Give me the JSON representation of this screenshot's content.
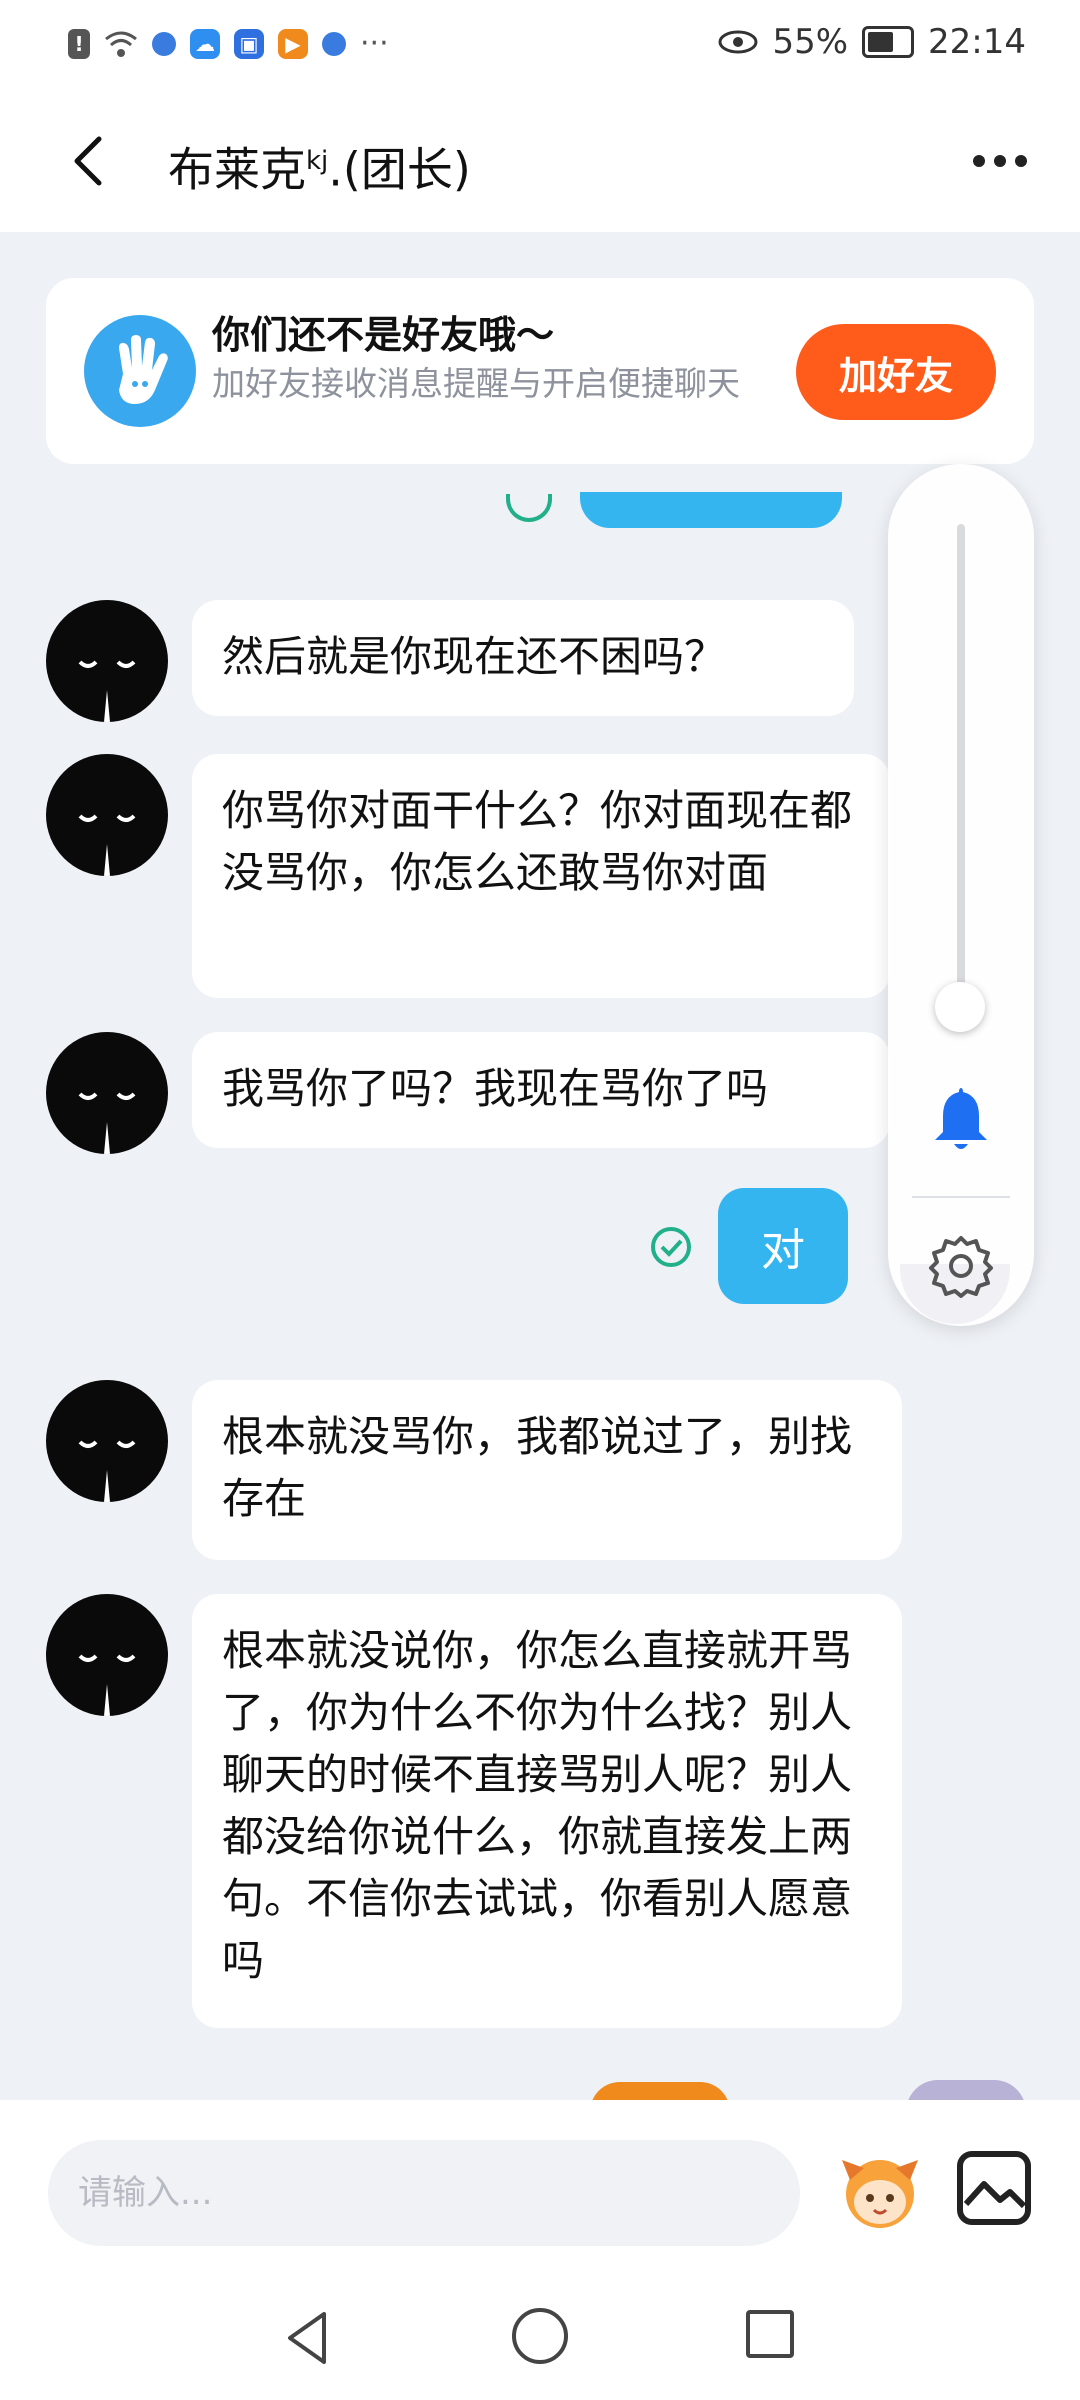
{
  "status_bar": {
    "battery": "55%",
    "time": "22:14",
    "overflow": "···",
    "icons": [
      "alert-icon",
      "wifi-icon",
      "app-icon",
      "cloud-icon",
      "app-icon",
      "video-icon",
      "app-icon",
      "eye-icon",
      "battery-icon"
    ]
  },
  "header": {
    "title": "布莱克",
    "title_sup": "kj",
    "title_suffix": ".(团长)"
  },
  "banner": {
    "title": "你们还不是好友哦～",
    "subtitle": "加好友接收消息提醒与开启便捷聊天",
    "button": "加好友"
  },
  "messages": [
    {
      "side": "in",
      "text": "然后就是你现在还不困吗？"
    },
    {
      "side": "in",
      "text": "你骂你对面干什么？你对面现在都没骂你，你怎么还敢骂你对面"
    },
    {
      "side": "in",
      "text": "我骂你了吗？我现在骂你了吗"
    },
    {
      "side": "out",
      "text": "对"
    },
    {
      "side": "in",
      "text": "根本就没骂你，我都说过了，别找存在"
    },
    {
      "side": "in",
      "text": "根本就没说你，你怎么直接就开骂了，你为什么不你为什么找？别人聊天的时候不直接骂别人呢？别人都没给你说什么，你就直接发上两句。不信你去试试，你看别人愿意吗"
    }
  ],
  "volume_panel": {
    "level": 0.02,
    "accent": "#1f6ff2"
  },
  "input": {
    "placeholder": "请输入..."
  },
  "colors": {
    "accent_blue": "#35b5f0",
    "accent_orange": "#ff5c1c",
    "chat_bg": "#eef1f6"
  }
}
